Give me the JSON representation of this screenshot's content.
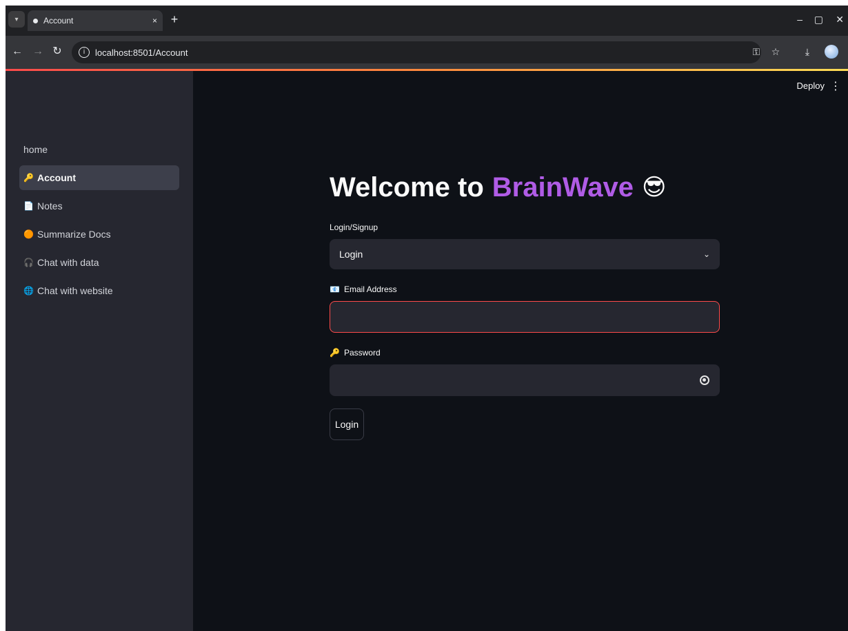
{
  "browser": {
    "tab_title": "Account",
    "tab_close": "×",
    "new_tab": "+",
    "url": "localhost:8501/Account",
    "window_controls": [
      "–",
      "▢",
      "✕"
    ],
    "toolbar_icons": [
      "key-icon",
      "star-icon",
      "download-icon",
      "profile-avatar"
    ]
  },
  "header": {
    "deploy_label": "Deploy",
    "menu_glyph": "⋮"
  },
  "sidebar": {
    "items": [
      {
        "label": "home",
        "icon": "",
        "active": false
      },
      {
        "label": "Account",
        "icon": "🔑",
        "active": true
      },
      {
        "label": "Notes",
        "icon": "📄",
        "active": false
      },
      {
        "label": "Summarize Docs",
        "icon": "🟠",
        "active": false
      },
      {
        "label": "Chat with data",
        "icon": "🎧",
        "active": false
      },
      {
        "label": "Chat with website",
        "icon": "🌐",
        "active": false
      }
    ]
  },
  "main": {
    "title_prefix": "Welcome to",
    "title_brand": "BrainWave",
    "title_emoji": "😎",
    "login_signup_label": "Login/Signup",
    "login_signup_value": "Login",
    "email_label": "Email Address",
    "email_icon": "📧",
    "email_value": "",
    "password_label": "Password",
    "password_icon": "🔑",
    "password_value": "",
    "login_button": "Login"
  },
  "colors": {
    "brand_purple": "#b05ce6",
    "focus_red": "#ff4b4b",
    "sidebar_bg": "#262730",
    "main_bg": "#0e1117"
  }
}
